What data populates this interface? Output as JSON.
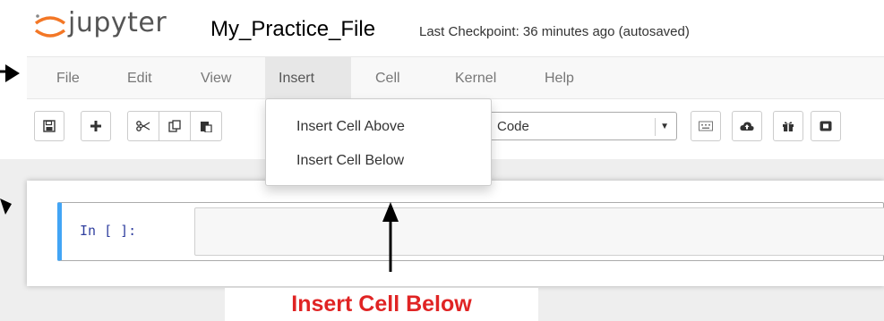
{
  "header": {
    "logo_text": "jupyter",
    "notebook_title": "My_Practice_File",
    "checkpoint_text": "Last Checkpoint: 36 minutes ago (autosaved)"
  },
  "menubar": {
    "items": [
      {
        "label": "File"
      },
      {
        "label": "Edit"
      },
      {
        "label": "View"
      },
      {
        "label": "Insert"
      },
      {
        "label": "Cell"
      },
      {
        "label": "Kernel"
      },
      {
        "label": "Help"
      }
    ],
    "open_menu": "Insert"
  },
  "insert_menu": {
    "items": [
      {
        "label": "Insert Cell Above"
      },
      {
        "label": "Insert Cell Below"
      }
    ]
  },
  "toolbar": {
    "buttons": [
      {
        "icon": "save-icon"
      },
      {
        "icon": "plus-icon"
      },
      {
        "icon": "cut-icon"
      },
      {
        "icon": "copy-icon"
      },
      {
        "icon": "paste-icon"
      },
      {
        "icon": "keyboard-icon"
      },
      {
        "icon": "cloud-upload-icon"
      },
      {
        "icon": "gift-icon"
      },
      {
        "icon": "presentation-icon"
      }
    ],
    "cell_type": "Code"
  },
  "cell": {
    "prompt": "In [ ]:"
  },
  "annotation": {
    "label": "Insert Cell Below"
  },
  "colors": {
    "cell_selected_border": "#42a5f5",
    "annotation_red": "#e02424",
    "logo_orange": "#f37726"
  }
}
